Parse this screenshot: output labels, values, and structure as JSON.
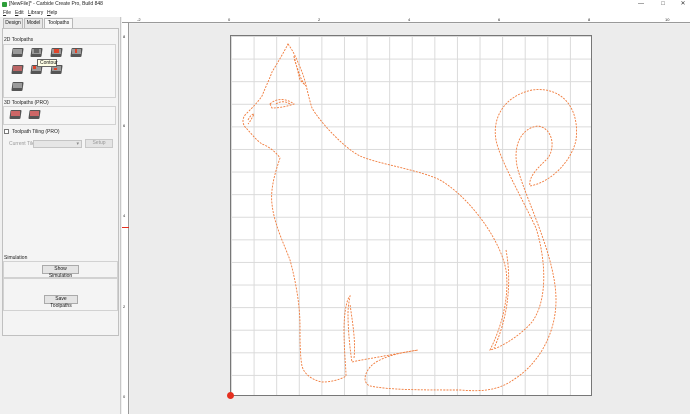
{
  "window": {
    "title": "[NewFile]* - Carbide Create Pro, Build 848",
    "minimize": "—",
    "maximize": "□",
    "close": "✕"
  },
  "menu": [
    "File",
    "Edit",
    "Library",
    "Help"
  ],
  "tabs": [
    "Design",
    "Model",
    "Toolpaths"
  ],
  "active_tab": "Toolpaths",
  "sections": {
    "toolpaths_2d": "2D Toolpaths",
    "toolpaths_3d": "3D Toolpaths (PRO)",
    "tiling": "Toolpath Tiling (PRO)",
    "current_tile": "Current Tile",
    "setup": "Setup",
    "simulation": "Simulation"
  },
  "icons_2d": [
    "contour-toolpath",
    "pocket-toolpath",
    "drill-toolpath",
    "vcarve-toolpath",
    "texture-toolpath",
    "advanced-vcarve-toolpath",
    "chamfer-toolpath",
    "rest-toolpath",
    "fillet-toolpath"
  ],
  "icons_3d": [
    "rough-3d-toolpath",
    "finish-3d-toolpath"
  ],
  "tooltip": "Contour",
  "buttons": {
    "show_simulation": "Show Simulation",
    "save_toolpaths": "Save Toolpaths"
  },
  "ruler": {
    "h_labels": [
      "-2",
      "0",
      "2",
      "4",
      "6",
      "8",
      "10"
    ],
    "v_labels": [
      "8",
      "6",
      "4",
      "2",
      "0"
    ]
  },
  "colors": {
    "toolpath": "#f07a3a",
    "origin_marker": "#e53020"
  }
}
